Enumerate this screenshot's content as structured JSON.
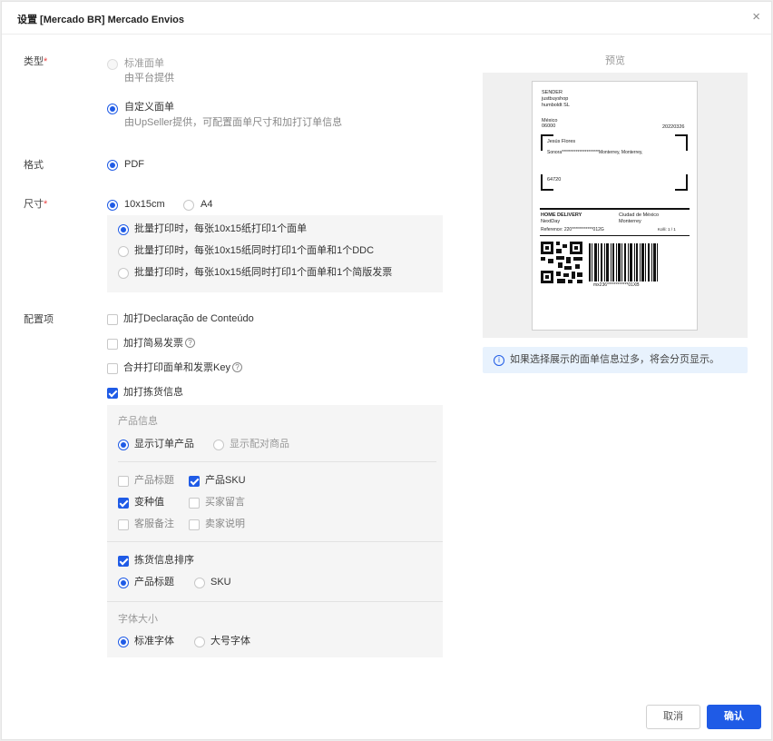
{
  "dialog": {
    "title": "设置 [Mercado BR] Mercado Envios",
    "close_glyph": "×"
  },
  "type_section": {
    "label": "类型",
    "required_mark": "*",
    "options": [
      {
        "label": "标准面单",
        "desc": "由平台提供",
        "selected": false
      },
      {
        "label": "自定义面单",
        "desc": "由UpSeller提供，可配置面单尺寸和加打订单信息",
        "selected": true
      }
    ]
  },
  "format_section": {
    "label": "格式",
    "option": "PDF"
  },
  "size_section": {
    "label": "尺寸",
    "required_mark": "*",
    "options": [
      "10x15cm",
      "A4"
    ],
    "print_modes": [
      "批量打印时，每张10x15纸打印1个面单",
      "批量打印时，每张10x15纸同时打印1个面单和1个DDC",
      "批量打印时，每张10x15纸同时打印1个面单和1个简版发票"
    ]
  },
  "config_section": {
    "label": "配置项",
    "checkboxes": [
      {
        "label": "加打Declaração de Conteúdo",
        "checked": false
      },
      {
        "label": "加打简易发票",
        "checked": false,
        "help": "?"
      },
      {
        "label": "合并打印面单和发票Key",
        "checked": false,
        "help": "?"
      },
      {
        "label": "加打拣货信息",
        "checked": true
      }
    ],
    "product_info": {
      "title": "产品信息",
      "display_options": [
        "显示订单产品",
        "显示配对商品"
      ],
      "fields": [
        {
          "label": "产品标题",
          "checked": false
        },
        {
          "label": "产品SKU",
          "checked": true
        },
        {
          "label": "变种值",
          "checked": true
        },
        {
          "label": "买家留言",
          "checked": false
        },
        {
          "label": "客服备注",
          "checked": false
        },
        {
          "label": "卖家说明",
          "checked": false
        }
      ]
    },
    "sort": {
      "label": "拣货信息排序",
      "options": [
        "产品标题",
        "SKU"
      ]
    },
    "font": {
      "title": "字体大小",
      "options": [
        "标准字体",
        "大号字体"
      ]
    }
  },
  "preview": {
    "title": "预览",
    "label_doc": {
      "sender_label": "SENDER",
      "sender_shop": "justbuyshop",
      "sender_name": "humboldt SL",
      "country": "México",
      "zip": "06000",
      "date": "20220326",
      "recipient_name": "Jesús Flores",
      "recipient_addr": "Sonora*********************Monterrey, Monterrey,",
      "recipient_zip": "64720",
      "service": "HOME DELIVERY",
      "city": "Ciudad de México",
      "speed": "NextDay",
      "dest": "Monterrey",
      "reference_label": "Reference:",
      "reference": "220************012G",
      "kolli": "Kolli: 1 / 1",
      "barcode_text": "mx236************01XB"
    },
    "notice": "如果选择展示的面单信息过多，将会分页显示。",
    "notice_icon": "i"
  },
  "footer": {
    "cancel": "取消",
    "confirm": "确认"
  },
  "colors": {
    "accent": "#1f5be6",
    "required": "#e94646"
  }
}
